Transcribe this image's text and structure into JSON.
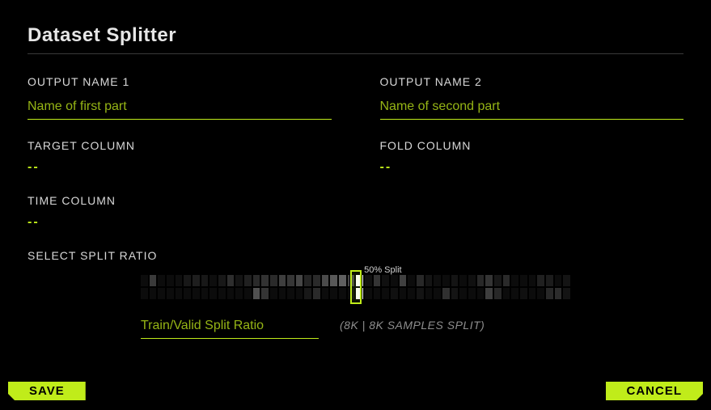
{
  "title": "Dataset Splitter",
  "output1": {
    "label": "OUTPUT NAME 1",
    "placeholder": "Name of first part",
    "value": ""
  },
  "output2": {
    "label": "OUTPUT NAME 2",
    "placeholder": "Name of second part",
    "value": ""
  },
  "target_col": {
    "label": "TARGET COLUMN",
    "value": "--"
  },
  "fold_col": {
    "label": "FOLD COLUMN",
    "value": "--"
  },
  "time_col": {
    "label": "TIME COLUMN",
    "value": "--"
  },
  "split": {
    "section_label": "SELECT SPLIT RATIO",
    "handle_label": "50% Split",
    "percent": 50,
    "ratio_placeholder": "Train/Valid Split Ratio",
    "ratio_value": "",
    "samples_hint": "(8K | 8K SAMPLES SPLIT)",
    "cells_row1": [
      12,
      58,
      12,
      12,
      14,
      24,
      30,
      24,
      14,
      24,
      46,
      20,
      32,
      42,
      50,
      42,
      62,
      54,
      70,
      36,
      42,
      74,
      88,
      96,
      70,
      255,
      16,
      52,
      16,
      12,
      64,
      12,
      40,
      20,
      14,
      12,
      20,
      12,
      16,
      40,
      52,
      24,
      42,
      12,
      12,
      12,
      32,
      28,
      12,
      20
    ],
    "cells_row2": [
      12,
      12,
      12,
      12,
      12,
      12,
      12,
      12,
      12,
      12,
      12,
      12,
      12,
      80,
      52,
      12,
      12,
      12,
      12,
      24,
      42,
      12,
      12,
      12,
      12,
      255,
      12,
      12,
      12,
      16,
      12,
      12,
      20,
      12,
      12,
      48,
      20,
      12,
      12,
      12,
      62,
      40,
      12,
      12,
      16,
      12,
      12,
      40,
      44,
      20
    ]
  },
  "buttons": {
    "save": "SAVE",
    "cancel": "CANCEL"
  }
}
